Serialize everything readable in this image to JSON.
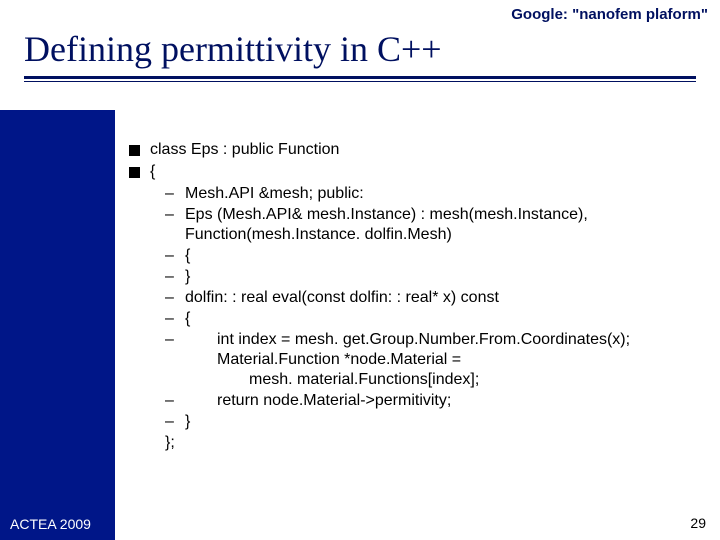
{
  "header": {
    "tag": "Google: \"nanofem plaform\""
  },
  "title": "Defining permittivity in C++",
  "top_items": [
    "class Eps : public Function",
    "{"
  ],
  "sub_items": [
    {
      "lines": [
        "Mesh.API &mesh; public:"
      ]
    },
    {
      "lines": [
        "Eps (Mesh.API& mesh.Instance) : mesh(mesh.Instance),",
        "Function(mesh.Instance. dolfin.Mesh)"
      ]
    },
    {
      "lines": [
        "{"
      ]
    },
    {
      "lines": [
        "}"
      ]
    },
    {
      "lines": [
        "dolfin: : real eval(const dolfin: : real* x) const"
      ]
    },
    {
      "lines": [
        "{"
      ]
    },
    {
      "lines": [
        "    int index = mesh. get.Group.Number.From.Coordinates(x);",
        "    Material.Function *node.Material =",
        "        mesh. material.Functions[index];"
      ]
    },
    {
      "lines": [
        "    return node.Material->permitivity;"
      ]
    },
    {
      "lines": [
        "}"
      ]
    }
  ],
  "closer": "};",
  "footer": {
    "left": "ACTEA 2009",
    "right": "29"
  }
}
